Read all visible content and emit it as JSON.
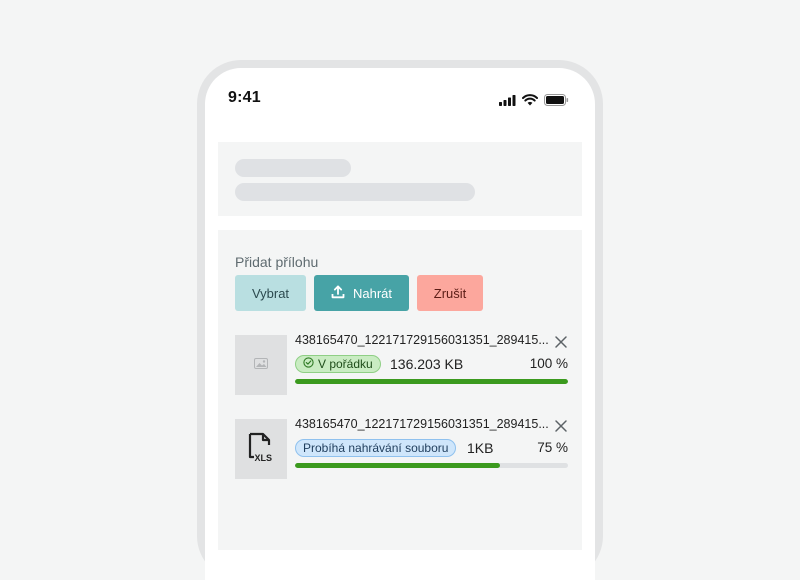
{
  "status_bar": {
    "time": "9:41",
    "icons": [
      "cellular-signal-icon",
      "wifi-icon",
      "battery-icon"
    ]
  },
  "attachment": {
    "label": "Přidat přílohu",
    "buttons": {
      "select": "Vybrat",
      "upload": "Nahrát",
      "cancel": "Zrušit"
    },
    "files": [
      {
        "name": "438165470_122171729156031351_289415...",
        "status": "V pořádku",
        "size": "136.203 KB",
        "progress_text": "100 %",
        "progress": 1.0,
        "thumbnail": "image-file-icon"
      },
      {
        "name": "438165470_122171729156031351_289415...",
        "status": "Probíhá nahrávání souboru",
        "size": "1KB",
        "progress_text": "75 %",
        "progress": 0.75,
        "thumbnail": "xls-file-icon",
        "thumbnail_label": "XLS"
      }
    ]
  },
  "colors": {
    "select_button": "#b9dfe1",
    "upload_button": "#47a3a6",
    "cancel_button": "#fca79d",
    "progress_fill": "#3b9a1e",
    "status_ok": "#c9ecc2",
    "status_uploading": "#cfe6fb"
  }
}
